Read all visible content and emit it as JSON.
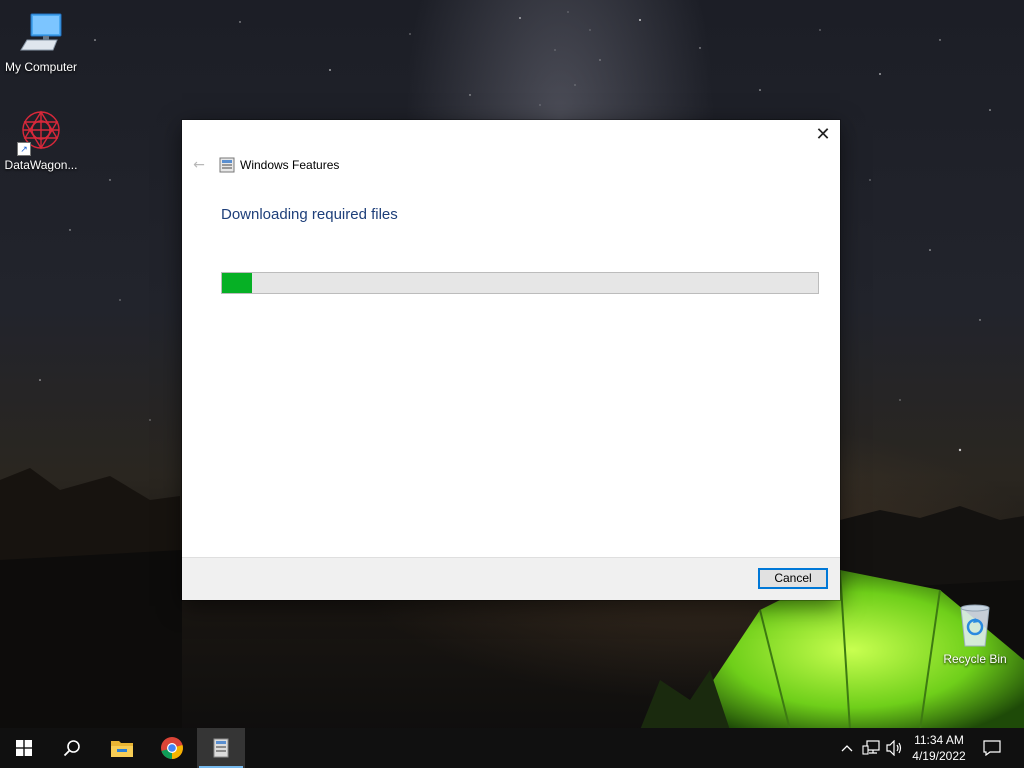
{
  "desktop": {
    "icons": [
      {
        "label": "My Computer",
        "icon": "computer-icon"
      },
      {
        "label": "DataWagon...",
        "icon": "datawagon-icon"
      },
      {
        "label": "Recycle Bin",
        "icon": "recycle-bin-icon"
      }
    ]
  },
  "dialog": {
    "title": "Windows Features",
    "close_label": "✕",
    "back_label": "←",
    "heading": "Downloading required files",
    "progress_percent": 5,
    "cancel_label": "Cancel",
    "accent_color": "#0078d7",
    "progress_color": "#06b025"
  },
  "taskbar": {
    "items": [
      "start-icon",
      "search-icon",
      "file-explorer-icon",
      "chrome-icon",
      "windows-features-icon"
    ],
    "tray_icons": [
      "chevron-up-icon",
      "network-icon",
      "volume-icon",
      "notification-icon"
    ],
    "time": "11:34 AM",
    "date": "4/19/2022"
  }
}
